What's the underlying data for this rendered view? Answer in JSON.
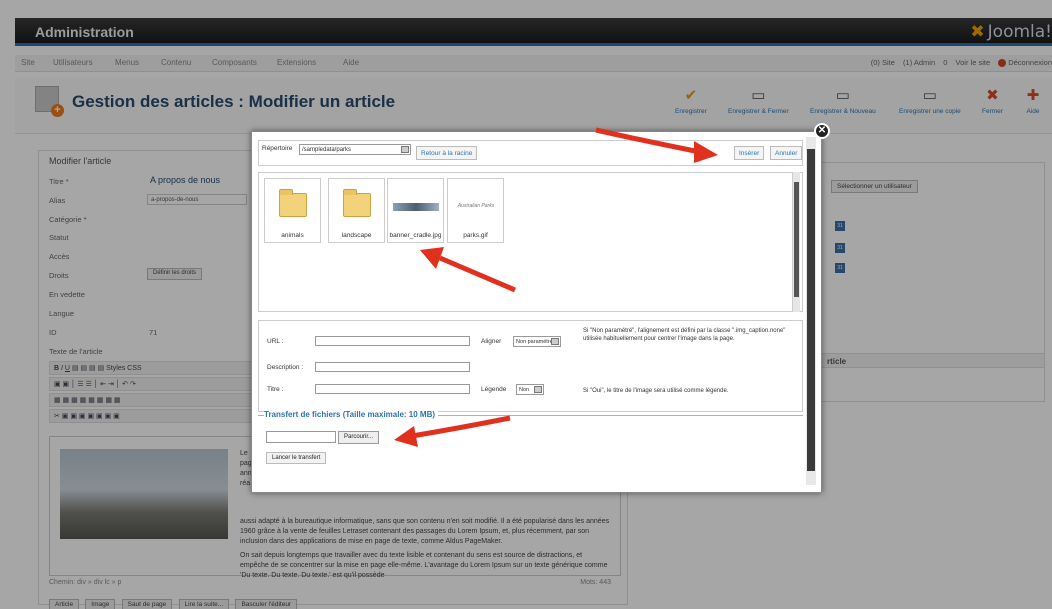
{
  "app": {
    "title": "Administration",
    "logo": "Joomla!"
  },
  "menu": {
    "items": [
      "Site",
      "Utilisateurs",
      "Menus",
      "Contenu",
      "Composants",
      "Extensions",
      "Aide"
    ],
    "status": {
      "site": "(0) Site",
      "admin": "(1) Admin",
      "messages": "0",
      "view_site": "Voir le site",
      "logout": "Déconnexion"
    }
  },
  "header": {
    "title": "Gestion des articles : Modifier un article"
  },
  "toolbar": [
    {
      "label": "Enregistrer",
      "icon": "check-icon"
    },
    {
      "label": "Enregistrer & Fermer",
      "icon": "save-close-icon"
    },
    {
      "label": "Enregistrer & Nouveau",
      "icon": "save-new-icon"
    },
    {
      "label": "Enregistrer une copie",
      "icon": "save-copy-icon"
    },
    {
      "label": "Fermer",
      "icon": "close-icon"
    },
    {
      "label": "Aide",
      "icon": "help-icon"
    }
  ],
  "form": {
    "legend": "Modifier l'article",
    "labels": {
      "title": "Titre *",
      "alias": "Alias",
      "category": "Catégorie *",
      "status": "Statut",
      "access": "Accès",
      "rights": "Droits",
      "featured": "En vedette",
      "language": "Langue",
      "id": "ID",
      "text": "Texte de l'article"
    },
    "title_value": "A propos de nous",
    "alias_value": "a-propos-de-nous",
    "rights_button": "Définir les droits",
    "id_value": "71",
    "styles_label": "Styles CSS",
    "editor_text": [
      "Le",
      "pag",
      "ann",
      "réa",
      "aussi adapté à la bureautique informatique, sans que son contenu n'en soit modifié. Il a été popularisé dans les années 1960 grâce à la vente de feuilles Letraset contenant des passages du Lorem Ipsum, et, plus récemment, par son inclusion dans des applications de mise en page de texte, comme Aldus PageMaker.",
      "On sait depuis longtemps que travailler avec du texte lisible et contenant du sens est source de distractions, et empêche de se concentrer sur la mise en page elle-même. L'avantage du Lorem Ipsum sur un texte générique comme 'Du texte. Du texte. Du texte.' est qu'il possède"
    ],
    "path": "Chemin: div » div lc » p",
    "word_count": "Mots: 443",
    "bottom_buttons": [
      "Article",
      "Image",
      "Saut de page",
      "Lire la suite...",
      "Basculer l'éditeur"
    ]
  },
  "right_panel": {
    "select_user": "Sélectionner un utilisateur",
    "cal": "31",
    "section_title": "rticle"
  },
  "modal": {
    "directory_label": "Répertoire",
    "directory_value": "/sampledata/parks",
    "back_root": "Retour à la racine",
    "insert": "Insérer",
    "cancel": "Annuler",
    "files": [
      {
        "name": "animals",
        "type": "folder"
      },
      {
        "name": "landscape",
        "type": "folder"
      },
      {
        "name": "banner_cradle.jpg",
        "type": "image"
      },
      {
        "name": "parks.gif",
        "type": "image"
      }
    ],
    "gif_preview_text": "Australian Parks",
    "url_label": "URL :",
    "align_label": "Aligner",
    "align_value": "Non paramétré",
    "align_hint": "Si \"Non paramétré\", l'alignement est défini par la classe \".img_caption.none\" utilisée habituellement pour centrer l'image dans la page.",
    "description_label": "Description :",
    "title_label": "Titre :",
    "caption_label": "Légende",
    "caption_value": "Non",
    "caption_hint": "Si \"Oui\", le titre de l'image sera utilisé comme légende.",
    "upload_title": "Transfert de fichiers (Taille maximale: 10 MB)",
    "browse": "Parcourir...",
    "start_upload": "Lancer le transfert"
  },
  "colors": {
    "accent": "#2f73ad",
    "arrow": "#e0301e",
    "topbar": "#1c1c1c"
  }
}
